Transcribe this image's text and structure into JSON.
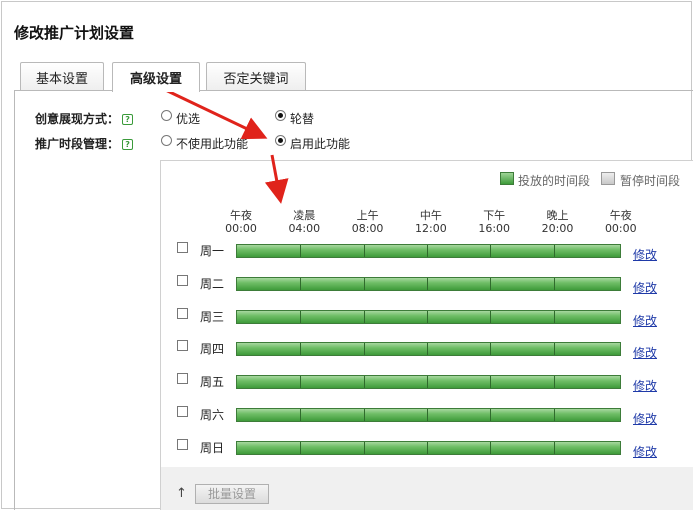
{
  "page_title": "修改推广计划设置",
  "tabs": [
    {
      "label": "基本设置",
      "active": false
    },
    {
      "label": "高级设置",
      "active": true
    },
    {
      "label": "否定关键词",
      "active": false
    }
  ],
  "creative_display": {
    "label": "创意展现方式：",
    "options": [
      {
        "label": "优选",
        "selected": false
      },
      {
        "label": "轮替",
        "selected": true
      }
    ]
  },
  "schedule_mgmt": {
    "label": "推广时段管理：",
    "options": [
      {
        "label": "不使用此功能",
        "selected": false
      },
      {
        "label": "启用此功能",
        "selected": true
      }
    ]
  },
  "legend": {
    "active_label": "投放的时间段",
    "paused_label": "暂停时间段",
    "active_color": "#4ea84a",
    "paused_color": "#d0d0d0"
  },
  "hour_markers": [
    {
      "name": "午夜",
      "time": "00:00"
    },
    {
      "name": "凌晨",
      "time": "04:00"
    },
    {
      "name": "上午",
      "time": "08:00"
    },
    {
      "name": "中午",
      "time": "12:00"
    },
    {
      "name": "下午",
      "time": "16:00"
    },
    {
      "name": "晚上",
      "time": "20:00"
    },
    {
      "name": "午夜",
      "time": "00:00"
    }
  ],
  "days": [
    {
      "label": "周一",
      "checked": false,
      "edit_label": "修改"
    },
    {
      "label": "周二",
      "checked": false,
      "edit_label": "修改"
    },
    {
      "label": "周三",
      "checked": false,
      "edit_label": "修改"
    },
    {
      "label": "周四",
      "checked": false,
      "edit_label": "修改"
    },
    {
      "label": "周五",
      "checked": false,
      "edit_label": "修改"
    },
    {
      "label": "周六",
      "checked": false,
      "edit_label": "修改"
    },
    {
      "label": "周日",
      "checked": false,
      "edit_label": "修改"
    }
  ],
  "footer": {
    "up_icon": "up-arrow-icon",
    "batch_label": "批量设置"
  },
  "annotation_color": "#e0231b"
}
